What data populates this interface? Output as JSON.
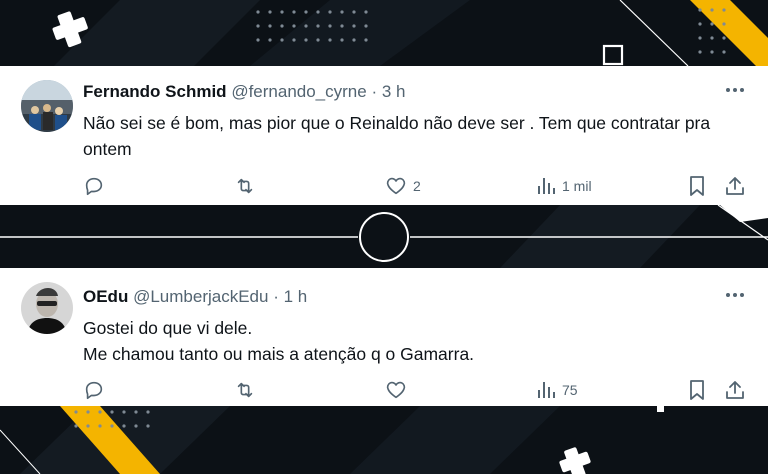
{
  "colors": {
    "background": "#0c1116",
    "accent_yellow": "#f4b400",
    "card": "#ffffff",
    "text_primary": "#0f1419",
    "text_secondary": "#536471"
  },
  "tweets": [
    {
      "name": "Fernando Schmid",
      "handle": "@fernando_cyrne",
      "separator": "·",
      "time": "3 h",
      "text": "Não sei se é bom, mas pior que o Reinaldo não deve ser . Tem que contratar pra ontem",
      "likes": "2",
      "views": "1 mil",
      "avatar": "stadium-crowd-photo"
    },
    {
      "name": "OEdu",
      "handle": "@LumberjackEdu",
      "separator": "·",
      "time": "1 h",
      "text_line1": "Gostei do que vi dele.",
      "text_line2": "Me chamou tanto ou mais a atenção q o Gamarra.",
      "likes": "",
      "views": "75",
      "avatar": "person-with-glasses-photo"
    }
  ]
}
